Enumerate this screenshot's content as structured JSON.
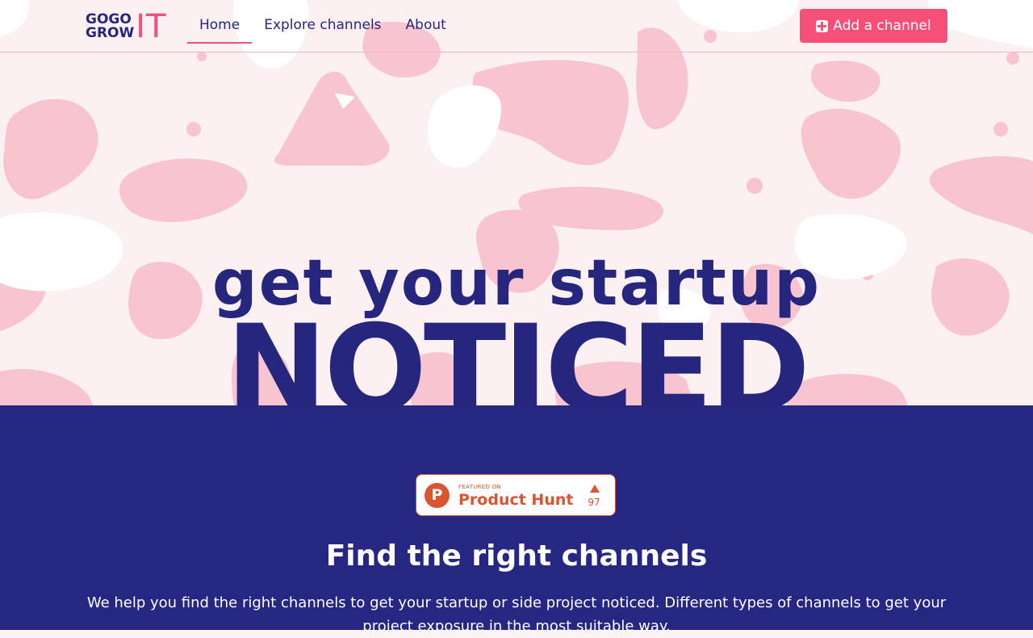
{
  "header": {
    "logo": {
      "line1": "GOGO",
      "line2": "GROW",
      "suffix": "IT"
    },
    "nav": [
      {
        "label": "Home",
        "active": true
      },
      {
        "label": "Explore channels",
        "active": false
      },
      {
        "label": "About",
        "active": false
      }
    ],
    "cta_label": "Add a channel"
  },
  "hero": {
    "line1": "get your startup",
    "line2": "NOTICED"
  },
  "badge": {
    "featured_label": "FEATURED ON",
    "name": "Product Hunt",
    "logo_letter": "P",
    "votes": "97"
  },
  "section": {
    "title": "Find the right channels",
    "description": "We help you find the right channels to get your startup or side project noticed. Different types of channels to get your project exposure in the most suitable way."
  },
  "colors": {
    "navy": "#26267f",
    "pink": "#f0517c",
    "blob_pink": "#f8c4cf",
    "product_hunt": "#da552f"
  }
}
